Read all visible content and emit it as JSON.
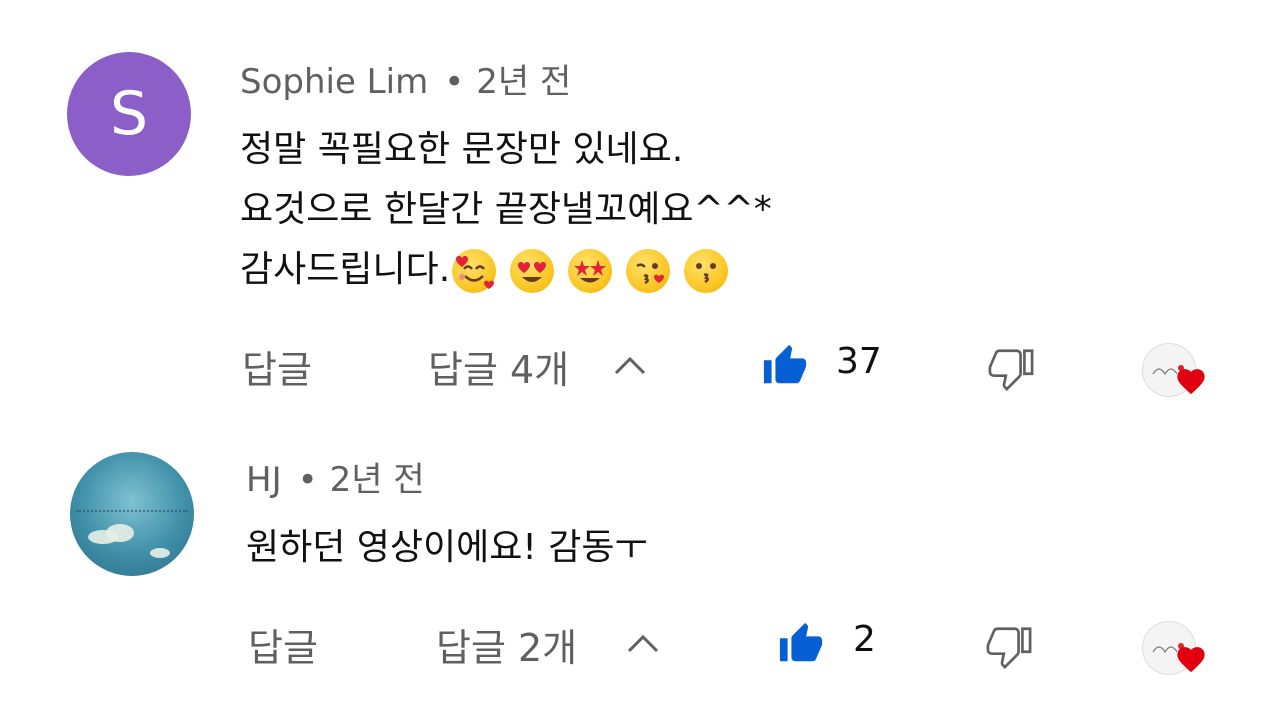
{
  "comments": [
    {
      "author": "Sophie Lim",
      "separator": "•",
      "time": "2년 전",
      "avatar_letter": "S",
      "avatar_color": "#8c5fc8",
      "lines": [
        "정말 꼭필요한 문장만 있네요.",
        "요것으로 한달간 끝장낼꼬예요^^*",
        "감사드립니다."
      ],
      "emojis": [
        "smiling-face-with-hearts",
        "heart-eyes",
        "star-struck",
        "face-blowing-kiss",
        "kissing-face"
      ],
      "reply_label": "답글",
      "replies_label": "답글 4개",
      "likes": "37",
      "hearted": true
    },
    {
      "author": "HJ",
      "separator": "•",
      "time": "2년 전",
      "lines": [
        "원하던 영상이에요! 감동ㅜ"
      ],
      "reply_label": "답글",
      "replies_label": "답글 2개",
      "likes": "2",
      "hearted": true
    }
  ],
  "colors": {
    "like_blue": "#065fd4",
    "heart_red": "#e0000f",
    "meta_gray": "#606060"
  }
}
